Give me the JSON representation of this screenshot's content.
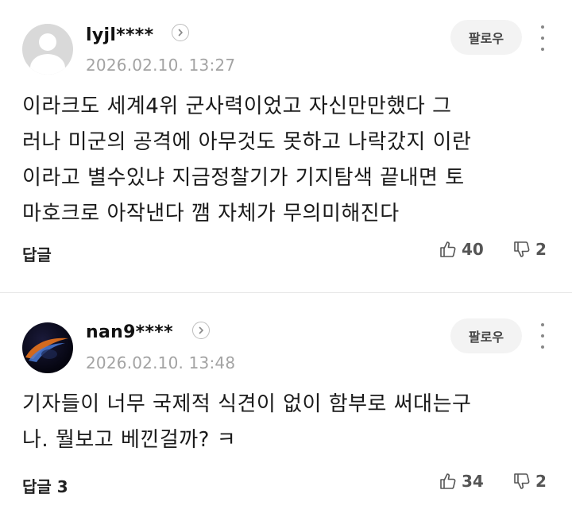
{
  "comments": [
    {
      "username": "lyjl****",
      "timestamp": "2026.02.10. 13:27",
      "follow_label": "팔로우",
      "text": "이라크도 세계4위 군사력이었고 자신만만했다 그\n러나 미군의 공격에 아무것도 못하고 나락갔지 이란\n이라고 별수있냐 지금정찰기가 기지탐색 끝내면 토\n마호크로 아작낸다 깸 자체가 무의미해진다",
      "reply_label": "답글",
      "likes": "40",
      "dislikes": "2"
    },
    {
      "username": "nan9****",
      "timestamp": "2026.02.10. 13:48",
      "follow_label": "팔로우",
      "text": "기자들이 너무 국제적 식견이 없이 함부로 써대는구\n나. 뭘보고 베낀걸까? ㅋ",
      "reply_label": "답글 3",
      "likes": "34",
      "dislikes": "2"
    }
  ],
  "icons": {
    "chevron": "chevron-right-icon",
    "more": "more-vertical-icon",
    "like": "thumbs-up-icon",
    "dislike": "thumbs-down-icon"
  },
  "colors": {
    "timestamp": "#a3a3a3",
    "follow_bg": "#f3f3f3"
  }
}
